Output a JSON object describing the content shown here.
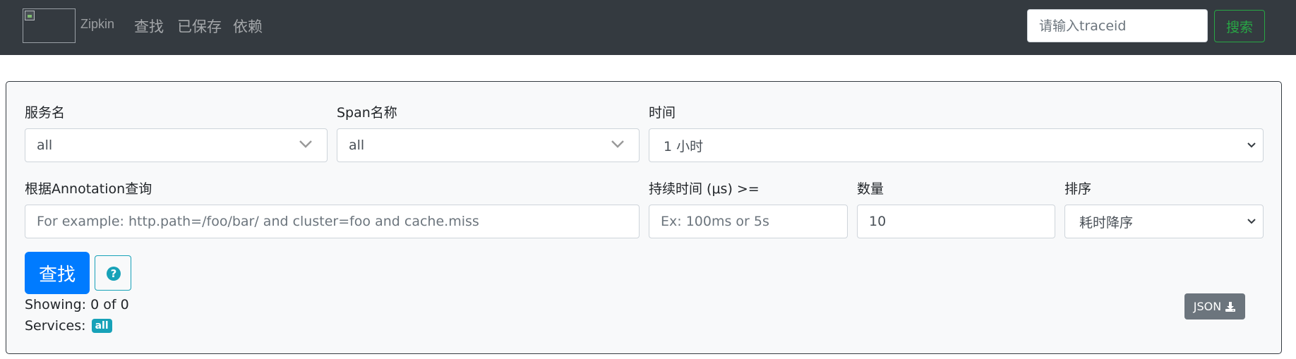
{
  "navbar": {
    "brand": "Zipkin",
    "links": [
      "查找",
      "已保存",
      "依赖"
    ],
    "trace_input_placeholder": "请输入traceid",
    "search_button": "搜索"
  },
  "search": {
    "service": {
      "label": "服务名",
      "value": "all"
    },
    "span": {
      "label": "Span名称",
      "value": "all"
    },
    "time": {
      "label": "时间",
      "value": "1 小时"
    },
    "annotation": {
      "label": "根据Annotation查询",
      "placeholder": "For example: http.path=/foo/bar/ and cluster=foo and cache.miss"
    },
    "duration": {
      "label": "持续时间 (μs) >=",
      "placeholder": "Ex: 100ms or 5s"
    },
    "limit": {
      "label": "数量",
      "value": "10"
    },
    "sort": {
      "label": "排序",
      "value": "耗时降序"
    },
    "find_button": "查找",
    "help_icon": "question-circle-icon"
  },
  "results": {
    "showing": "Showing: 0 of 0",
    "services_label": "Services:",
    "services_badge": "all",
    "json_button": "JSON"
  },
  "colors": {
    "navbar_bg": "#343a40",
    "primary": "#007bff",
    "success": "#28a745",
    "info": "#17a2b8",
    "secondary": "#6c757d",
    "card_bg": "#f8f9fa"
  }
}
